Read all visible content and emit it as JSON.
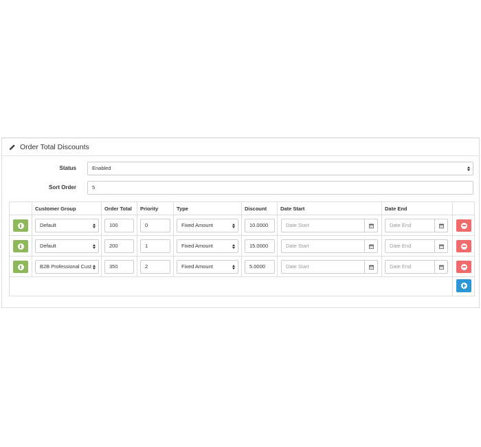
{
  "panel": {
    "title": "Order Total Discounts",
    "icon": "pencil-icon"
  },
  "form": {
    "status_label": "Status",
    "status_value": "Enabled",
    "sort_order_label": "Sort Order",
    "sort_order_value": "5"
  },
  "table": {
    "headers": [
      "",
      "Customer Group",
      "Order Total",
      "Priority",
      "Type",
      "Discount",
      "Date Start",
      "Date End",
      ""
    ],
    "rows": [
      {
        "customer_group": "Default",
        "order_total": "100",
        "priority": "0",
        "type": "Fixed Amount",
        "discount": "10.0000",
        "date_start_placeholder": "Date Start",
        "date_end_placeholder": "Date End"
      },
      {
        "customer_group": "Default",
        "order_total": "200",
        "priority": "1",
        "type": "Fixed Amount",
        "discount": "15.0000",
        "date_start_placeholder": "Date Start",
        "date_end_placeholder": "Date End"
      },
      {
        "customer_group": "B2B Professional Custo",
        "order_total": "350",
        "priority": "2",
        "type": "Fixed Amount",
        "discount": "5.0000",
        "date_start_placeholder": "Date Start",
        "date_end_placeholder": "Date End"
      }
    ]
  },
  "colors": {
    "info_button": "#8fb85a",
    "remove_button": "#f06b6b",
    "add_button": "#2d97d6"
  }
}
